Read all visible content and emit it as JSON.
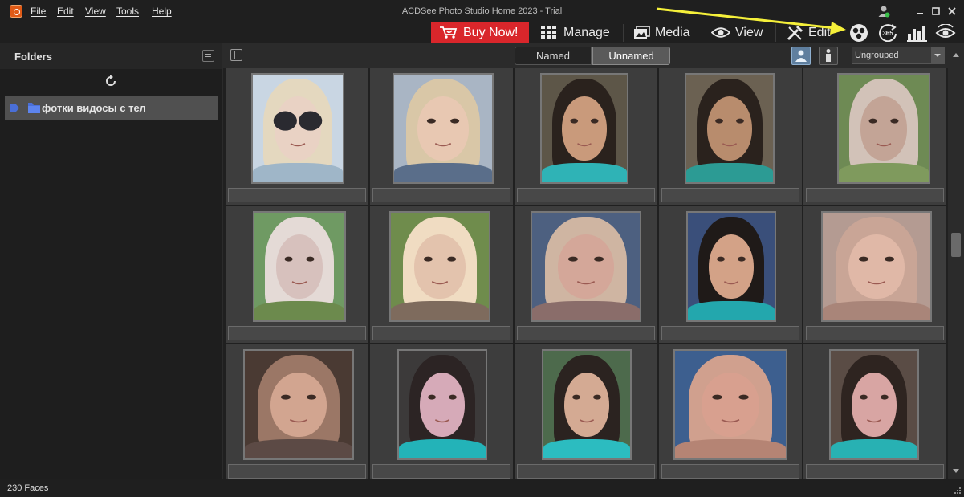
{
  "window": {
    "title": "ACDSee Photo Studio Home 2023 - Trial",
    "menu": [
      "File",
      "Edit",
      "View",
      "Tools",
      "Help"
    ],
    "controls": [
      "minimize",
      "maximize",
      "close"
    ]
  },
  "mode_bar": {
    "buy_now": "Buy Now!",
    "tabs": [
      "Manage",
      "Media",
      "View",
      "Edit"
    ],
    "icons": [
      "people-icon",
      "365-icon",
      "dashboard-icon",
      "develop-icon"
    ],
    "icon_365_text": "365"
  },
  "folders_panel": {
    "title": "Folders",
    "folder_label": "фотки видосы с тел"
  },
  "content_toolbar": {
    "named": "Named",
    "unnamed": "Unnamed",
    "group_value": "Ungrouped"
  },
  "status": {
    "count": "230 Faces"
  },
  "colors": {
    "accent": "#d9262b",
    "folder": "#4a6fd8",
    "annotation": "#f5f03a"
  },
  "faces": [
    {
      "bg": "#c9d6e3",
      "skin": "#e9d2c4",
      "hair": "#e4d8bf",
      "top": "#9fb6c8"
    },
    {
      "bg": "#a9b5c4",
      "skin": "#e8c8b2",
      "hair": "#d9c7a7",
      "top": "#5a6e8a"
    },
    {
      "bg": "#5d5648",
      "skin": "#c99a7b",
      "hair": "#2a221d",
      "top": "#2fb3b6"
    },
    {
      "bg": "#6b6152",
      "skin": "#b88c6d",
      "hair": "#2a221d",
      "top": "#2c9b94"
    },
    {
      "bg": "#6e8a54",
      "skin": "#c3a496",
      "hair": "#d2c2b8",
      "top": "#7f9a5d"
    },
    {
      "bg": "#6f9a63",
      "skin": "#d7c1bd",
      "hair": "#e4dad6",
      "top": "#6c8a4d"
    },
    {
      "bg": "#6f8c4c",
      "skin": "#e3c3ad",
      "hair": "#f0dcc2",
      "top": "#7e6b5d"
    },
    {
      "bg": "#4d6080",
      "skin": "#d4a799",
      "hair": "#cfb5a2",
      "top": "#8a6d6a"
    },
    {
      "bg": "#3a4f7a",
      "skin": "#d3a287",
      "hair": "#1f1a18",
      "top": "#23a7ad"
    },
    {
      "bg": "#b49b92",
      "skin": "#e0b8a7",
      "hair": "#c9a596",
      "top": "#a98579"
    },
    {
      "bg": "#4a3a33",
      "skin": "#d2a590",
      "hair": "#9b7766",
      "top": "#5c4a45"
    },
    {
      "bg": "#3c3a3a",
      "skin": "#d6aab8",
      "hair": "#2c2424",
      "top": "#23b3b8"
    },
    {
      "bg": "#4d6a4c",
      "skin": "#d4aa93",
      "hair": "#2b2320",
      "top": "#2cbcc0"
    },
    {
      "bg": "#3d5f8f",
      "skin": "#d8a08f",
      "hair": "#d0a08e",
      "top": "#b58474"
    },
    {
      "bg": "#5a4c45",
      "skin": "#d8a5a3",
      "hair": "#2e2420",
      "top": "#28b1b3"
    }
  ]
}
